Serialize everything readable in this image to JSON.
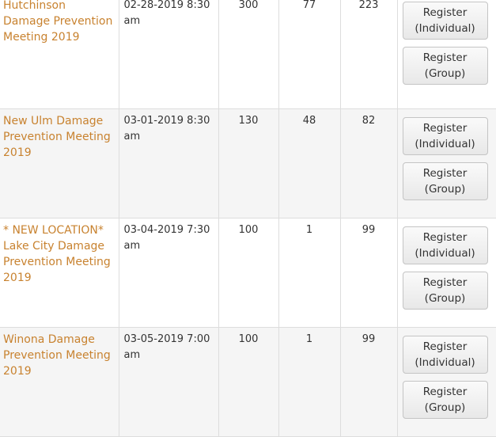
{
  "events": [
    {
      "name": "Hutchinson Damage Prevention Meeting 2019",
      "date": "02-28-2019 8:30 am",
      "capacity": "300",
      "registered": "77",
      "available": "223",
      "register_individual": [
        "Register",
        "(Individual)"
      ],
      "register_group": [
        "Register",
        "(Group)"
      ]
    },
    {
      "name": "New Ulm Damage Prevention Meeting 2019",
      "date": "03-01-2019 8:30 am",
      "capacity": "130",
      "registered": "48",
      "available": "82",
      "register_individual": [
        "Register",
        "(Individual)"
      ],
      "register_group": [
        "Register",
        "(Group)"
      ]
    },
    {
      "name": "* NEW LOCATION* Lake City Damage Prevention Meeting 2019",
      "date": "03-04-2019 7:30 am",
      "capacity": "100",
      "registered": "1",
      "available": "99",
      "register_individual": [
        "Register",
        "(Individual)"
      ],
      "register_group": [
        "Register",
        "(Group)"
      ]
    },
    {
      "name": "Winona Damage Prevention Meeting 2019",
      "date": "03-05-2019 7:00 am",
      "capacity": "100",
      "registered": "1",
      "available": "99",
      "register_individual": [
        "Register",
        "(Individual)"
      ],
      "register_group": [
        "Register",
        "(Group)"
      ]
    }
  ],
  "colors": {
    "link": "#c8822f",
    "alt_row_bg": "#f5f5f5",
    "border": "#dddddd"
  }
}
